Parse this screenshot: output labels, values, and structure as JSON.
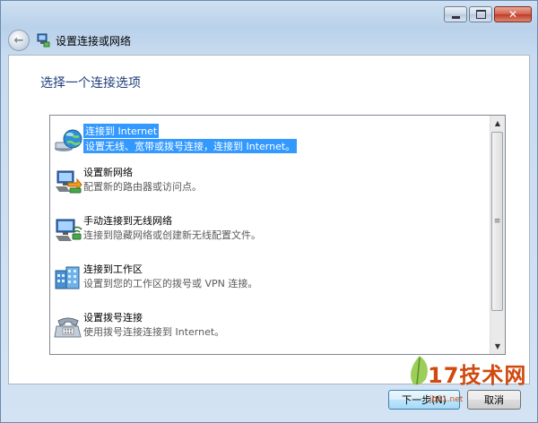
{
  "window": {
    "title": "设置连接或网络",
    "caption_buttons": {
      "minimize": "minimize-icon",
      "maximize": "maximize-icon",
      "close": "close-icon"
    }
  },
  "page": {
    "heading": "选择一个连接选项"
  },
  "options": [
    {
      "title": "连接到 Internet",
      "description": "设置无线、宽带或拨号连接，连接到 Internet。",
      "icon": "globe-network-icon",
      "selected": true
    },
    {
      "title": "设置新网络",
      "description": "配置新的路由器或访问点。",
      "icon": "router-setup-icon",
      "selected": false
    },
    {
      "title": "手动连接到无线网络",
      "description": "连接到隐藏网络或创建新无线配置文件。",
      "icon": "wireless-network-icon",
      "selected": false
    },
    {
      "title": "连接到工作区",
      "description": "设置到您的工作区的拨号或 VPN 连接。",
      "icon": "workplace-building-icon",
      "selected": false
    },
    {
      "title": "设置拨号连接",
      "description": "使用拨号连接连接到 Internet。",
      "icon": "telephone-modem-icon",
      "selected": false
    }
  ],
  "footer": {
    "next_label": "下一步(N)",
    "cancel_label": "取消"
  },
  "watermark": {
    "text": "17技术网",
    "sub": "jb51.net"
  },
  "colors": {
    "selection": "#3399ff",
    "heading": "#1e3f7a",
    "chrome": "#c8dbef"
  }
}
